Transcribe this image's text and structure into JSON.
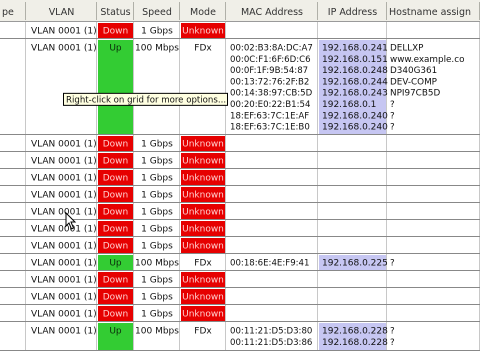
{
  "columns": [
    {
      "key": "type",
      "label": "pe"
    },
    {
      "key": "vlan",
      "label": "VLAN"
    },
    {
      "key": "status",
      "label": "Status"
    },
    {
      "key": "speed",
      "label": "Speed"
    },
    {
      "key": "mode",
      "label": "Mode"
    },
    {
      "key": "mac",
      "label": "MAC Address"
    },
    {
      "key": "ip",
      "label": "IP Address"
    },
    {
      "key": "hostname",
      "label": "Hostname assign"
    }
  ],
  "colors": {
    "up": "#33cc33",
    "down": "#e60000",
    "down_text": "#ffd0d0",
    "mode_unknown": "#e60000",
    "ip_highlight": "#c6c6f2",
    "grid_line": "#c8c8c8",
    "header_bg": "#f0efe8",
    "header_text": "#333333",
    "row_separator": "#888888",
    "tooltip_bg": "#ffffe1",
    "text": "#111111"
  },
  "tooltip": {
    "text": "Right-click on grid for more options..."
  },
  "rows": [
    {
      "vlan": "VLAN 0001 (1)",
      "status": "Down",
      "speed": "1 Gbps",
      "mode": "Unknown",
      "entries": []
    },
    {
      "vlan": "VLAN 0001 (1)",
      "status": "Up",
      "speed": "100 Mbps",
      "mode": "FDx",
      "entries": [
        {
          "mac": "00:02:B3:8A:DC:A7",
          "ip": "192.168.0.241",
          "hostname": "DELLXP"
        },
        {
          "mac": "00:0C:F1:6F:6D:C6",
          "ip": "192.168.0.151",
          "hostname": "www.example.co"
        },
        {
          "mac": "00:0F:1F:9B:54:87",
          "ip": "192.168.0.248",
          "hostname": "D340G361"
        },
        {
          "mac": "00:13:72:76:2F:B2",
          "ip": "192.168.0.244",
          "hostname": "DEV-COMP"
        },
        {
          "mac": "00:14:38:97:CB:5D",
          "ip": "192.168.0.243",
          "hostname": "NPI97CB5D"
        },
        {
          "mac": "00:20:E0:22:B1:54",
          "ip": "192.168.0.1",
          "hostname": "?"
        },
        {
          "mac": "18:EF:63:7C:1E:AF",
          "ip": "192.168.0.240",
          "hostname": "?"
        },
        {
          "mac": "18:EF:63:7C:1E:B0",
          "ip": "192.168.0.240",
          "hostname": "?"
        }
      ]
    },
    {
      "vlan": "VLAN 0001 (1)",
      "status": "Down",
      "speed": "1 Gbps",
      "mode": "Unknown",
      "entries": []
    },
    {
      "vlan": "VLAN 0001 (1)",
      "status": "Down",
      "speed": "1 Gbps",
      "mode": "Unknown",
      "entries": []
    },
    {
      "vlan": "VLAN 0001 (1)",
      "status": "Down",
      "speed": "1 Gbps",
      "mode": "Unknown",
      "entries": []
    },
    {
      "vlan": "VLAN 0001 (1)",
      "status": "Down",
      "speed": "1 Gbps",
      "mode": "Unknown",
      "entries": []
    },
    {
      "vlan": "VLAN 0001 (1)",
      "status": "Down",
      "speed": "1 Gbps",
      "mode": "Unknown",
      "entries": []
    },
    {
      "vlan": "VLAN 0001 (1)",
      "status": "Down",
      "speed": "1 Gbps",
      "mode": "Unknown",
      "entries": []
    },
    {
      "vlan": "VLAN 0001 (1)",
      "status": "Down",
      "speed": "1 Gbps",
      "mode": "Unknown",
      "entries": []
    },
    {
      "vlan": "VLAN 0001 (1)",
      "status": "Up",
      "speed": "100 Mbps",
      "mode": "FDx",
      "entries": [
        {
          "mac": "00:18:6E:4E:F9:41",
          "ip": "192.168.0.225",
          "hostname": "?"
        }
      ]
    },
    {
      "vlan": "VLAN 0001 (1)",
      "status": "Down",
      "speed": "1 Gbps",
      "mode": "Unknown",
      "entries": []
    },
    {
      "vlan": "VLAN 0001 (1)",
      "status": "Down",
      "speed": "1 Gbps",
      "mode": "Unknown",
      "entries": []
    },
    {
      "vlan": "VLAN 0001 (1)",
      "status": "Down",
      "speed": "1 Gbps",
      "mode": "Unknown",
      "entries": []
    },
    {
      "vlan": "VLAN 0001 (1)",
      "status": "Up",
      "speed": "100 Mbps",
      "mode": "FDx",
      "entries": [
        {
          "mac": "00:11:21:D5:D3:80",
          "ip": "192.168.0.228",
          "hostname": "?"
        },
        {
          "mac": "00:11:21:D5:D3:86",
          "ip": "192.168.0.228",
          "hostname": "?"
        }
      ]
    }
  ]
}
